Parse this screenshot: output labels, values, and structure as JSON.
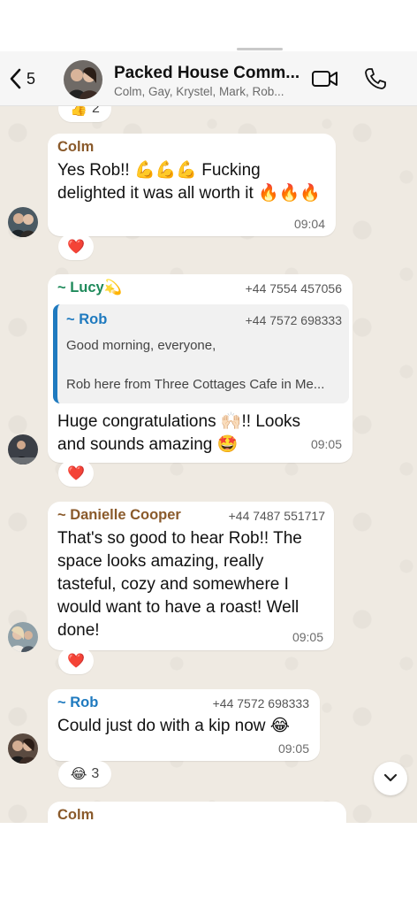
{
  "header": {
    "back_count": "5",
    "title": "Packed House Comm...",
    "subtitle": "Colm, Gay, Krystel, Mark, Rob..."
  },
  "colors": {
    "colm": "#8a5a2b",
    "lucy": "#1f8a5b",
    "rob": "#1f7abf",
    "danielle": "#8a5a2b",
    "chat_bg": "#efeae2"
  },
  "messages": [
    {
      "sender": "Colm",
      "text": "Yes Rob!! 💪💪💪 Fucking delighted it was all worth it 🔥🔥🔥",
      "time": "09:04",
      "reaction": "❤️"
    },
    {
      "sender": "~ Lucy💫",
      "phone": "+44 7554 457056",
      "quote": {
        "sender": "~ Rob",
        "phone": "+44 7572 698333",
        "line1": "Good morning, everyone,",
        "line2": "Rob here from Three Cottages Cafe in Me..."
      },
      "text": "Huge congratulations 🙌🏻!! Looks and sounds amazing 🤩",
      "time": "09:05",
      "reaction": "❤️"
    },
    {
      "sender": "~ Danielle Cooper",
      "phone": "+44 7487 551717",
      "text": "That's so good to hear Rob!! The space looks amazing, really tasteful, cozy and somewhere I would want to have a roast! Well done!",
      "time": "09:05",
      "reaction": "❤️"
    },
    {
      "sender": "~ Rob",
      "phone": "+44 7572 698333",
      "text": "Could just do with a kip now 😂",
      "time": "09:05",
      "reaction": "😂",
      "reaction_count": "3"
    },
    {
      "sender": "Colm"
    }
  ],
  "top_reaction": {
    "emoji": "👍",
    "count": "2"
  }
}
